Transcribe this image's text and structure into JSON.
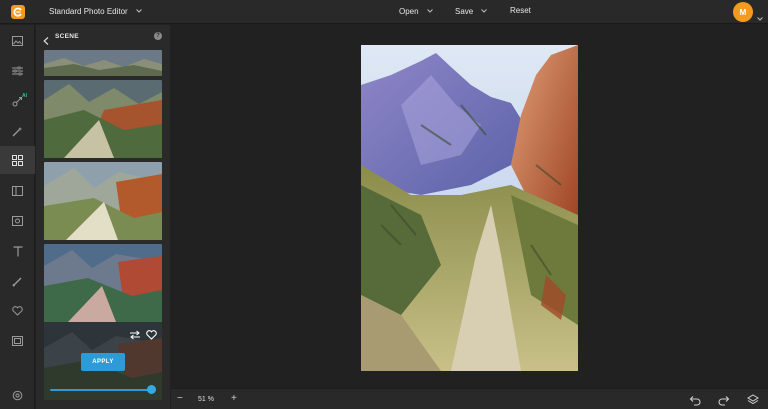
{
  "app": {
    "title": "Standard Photo Editor",
    "menu": {
      "open": "Open",
      "save": "Save",
      "reset": "Reset"
    },
    "avatar_initial": "M",
    "accent_color": "#2f9bd6",
    "brand_color": "#f39a1c"
  },
  "rail": {
    "items": [
      {
        "icon": "image-icon"
      },
      {
        "icon": "adjustments-icon"
      },
      {
        "icon": "ai-effects-icon",
        "badge": "AI"
      },
      {
        "icon": "magic-wand-icon"
      },
      {
        "icon": "effects-grid-icon",
        "active": true
      },
      {
        "icon": "layout-icon"
      },
      {
        "icon": "frame-icon"
      },
      {
        "icon": "text-icon"
      },
      {
        "icon": "brush-icon"
      },
      {
        "icon": "favorites-heart-icon"
      },
      {
        "icon": "texture-icon"
      },
      {
        "icon": "settings-icon"
      }
    ]
  },
  "panel": {
    "title": "SCENE",
    "help": "?",
    "apply_label": "APPLY",
    "intensity": 1.0
  },
  "bottombar": {
    "zoom_minus": "−",
    "zoom": "51 %",
    "zoom_plus": "+"
  }
}
